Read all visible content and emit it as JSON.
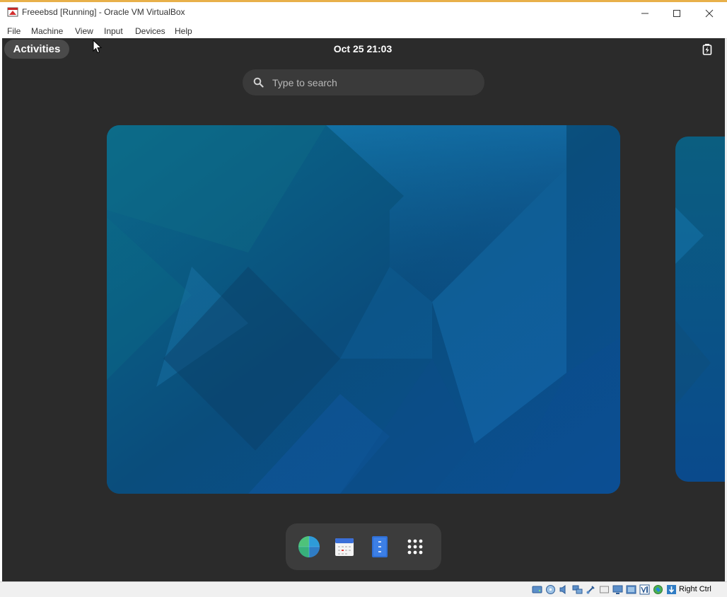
{
  "window": {
    "title": "Freeebsd [Running] - Oracle VM VirtualBox",
    "menu": [
      "File",
      "Machine",
      "View",
      "Input",
      "Devices",
      "Help"
    ]
  },
  "topbar": {
    "activities_label": "Activities",
    "clock": "Oct 25  21:03"
  },
  "search": {
    "placeholder": "Type to search"
  },
  "dock": {
    "items": [
      "web-browser",
      "calendar",
      "text-editor",
      "app-grid"
    ]
  },
  "statusbar": {
    "host_key": "Right Ctrl"
  },
  "colors": {
    "shell_bg": "#2b2b2b",
    "wallpaper_dark": "#0a3d64",
    "wallpaper_light": "#1e8fd0"
  }
}
